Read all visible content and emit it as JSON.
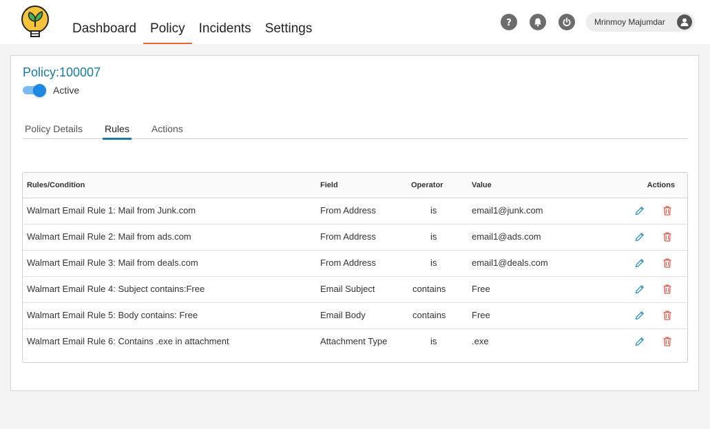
{
  "nav": {
    "items": [
      {
        "label": "Dashboard",
        "active": false
      },
      {
        "label": "Policy",
        "active": true
      },
      {
        "label": "Incidents",
        "active": false
      },
      {
        "label": "Settings",
        "active": false
      }
    ]
  },
  "header": {
    "icons": [
      "help-icon",
      "bell-icon",
      "power-icon"
    ],
    "user_name": "Mrinmoy Majumdar"
  },
  "policy": {
    "title": "Policy:100007",
    "status_label": "Active",
    "active": true
  },
  "tabs": [
    {
      "label": "Policy Details",
      "active": false
    },
    {
      "label": "Rules",
      "active": true
    },
    {
      "label": "Actions",
      "active": false
    }
  ],
  "rules_table": {
    "headers": {
      "rule": "Rules/Condition",
      "field": "Field",
      "operator": "Operator",
      "value": "Value",
      "actions": "Actions"
    },
    "rows": [
      {
        "rule": "Walmart Email Rule 1: Mail from Junk.com",
        "field": "From Address",
        "operator": "is",
        "value": "email1@junk.com"
      },
      {
        "rule": "Walmart Email Rule 2: Mail from ads.com",
        "field": "From Address",
        "operator": "is",
        "value": "email1@ads.com"
      },
      {
        "rule": "Walmart Email Rule 3: Mail from deals.com",
        "field": "From Address",
        "operator": "is",
        "value": "email1@deals.com"
      },
      {
        "rule": "Walmart Email Rule 4: Subject contains:Free",
        "field": "Email Subject",
        "operator": "contains",
        "value": "Free"
      },
      {
        "rule": "Walmart Email Rule 5: Body contains: Free",
        "field": "Email Body",
        "operator": "contains",
        "value": "Free"
      },
      {
        "rule": "Walmart Email Rule 6: Contains .exe in attachment",
        "field": "Attachment Type",
        "operator": "is",
        "value": ".exe"
      }
    ],
    "row_actions": [
      "edit-icon",
      "delete-icon"
    ]
  },
  "colors": {
    "accent_nav": "#e8633a",
    "accent_blue": "#1a7aa0",
    "toggle_on": "#1e88e5",
    "edit_icon": "#2a8fbf",
    "delete_icon": "#e05a4a"
  }
}
